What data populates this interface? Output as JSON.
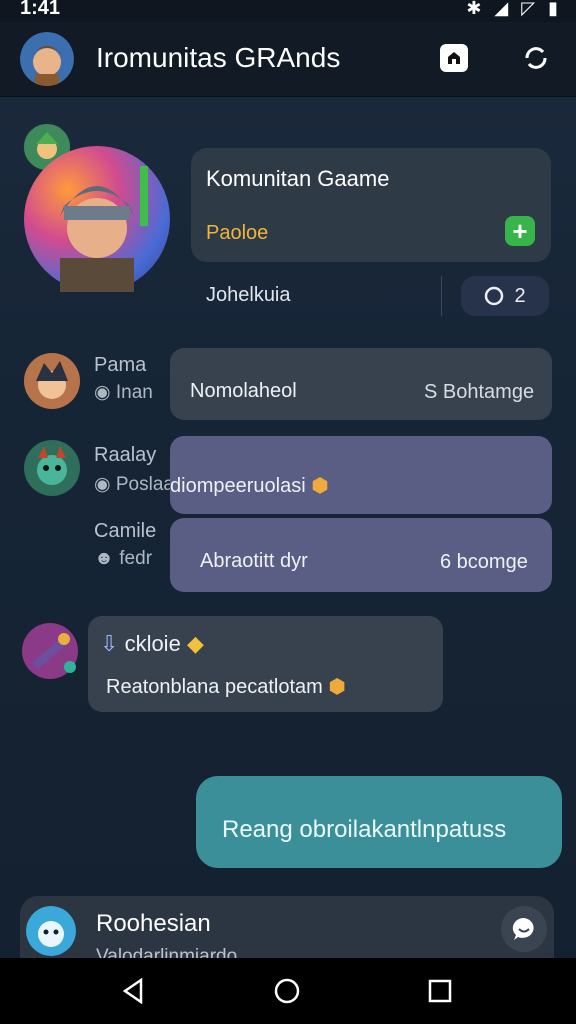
{
  "status_bar": {
    "time": "1:41",
    "icons": "✱ ◢ ◸ ▮"
  },
  "header": {
    "title": "Iromunitas GRAnds",
    "home_icon": "home-icon",
    "refresh_icon": "refresh-icon"
  },
  "community": {
    "name": "Komunitan Gaame",
    "subtitle": "Paoloe",
    "members_label": "Johelkuia",
    "count": "2",
    "accent": "#38b54a"
  },
  "messages": [
    {
      "sender": "Pama",
      "sender_sub": "Inan",
      "text": "Nomolaheol",
      "meta": "S Bohtamge"
    },
    {
      "sender": "Raalay",
      "sender_sub": "Poslaa",
      "text": "diompeeruolasi"
    },
    {
      "sender": "Camile",
      "sender_sub": "fedr",
      "text": "Abraotitt dyr",
      "meta": "6 bcomge"
    },
    {
      "sender": "ckloie",
      "text": "Reatonblana pecatlotam"
    }
  ],
  "outgoing": {
    "text": "Reang obroilakantlnpatuss",
    "color": "#3b8f99"
  },
  "bottom_item": {
    "title": "Roohesian",
    "subtitle": "Valodarlinmiardo"
  },
  "nav": {
    "back": "back-icon",
    "home": "home-circle-icon",
    "recents": "recents-icon"
  }
}
